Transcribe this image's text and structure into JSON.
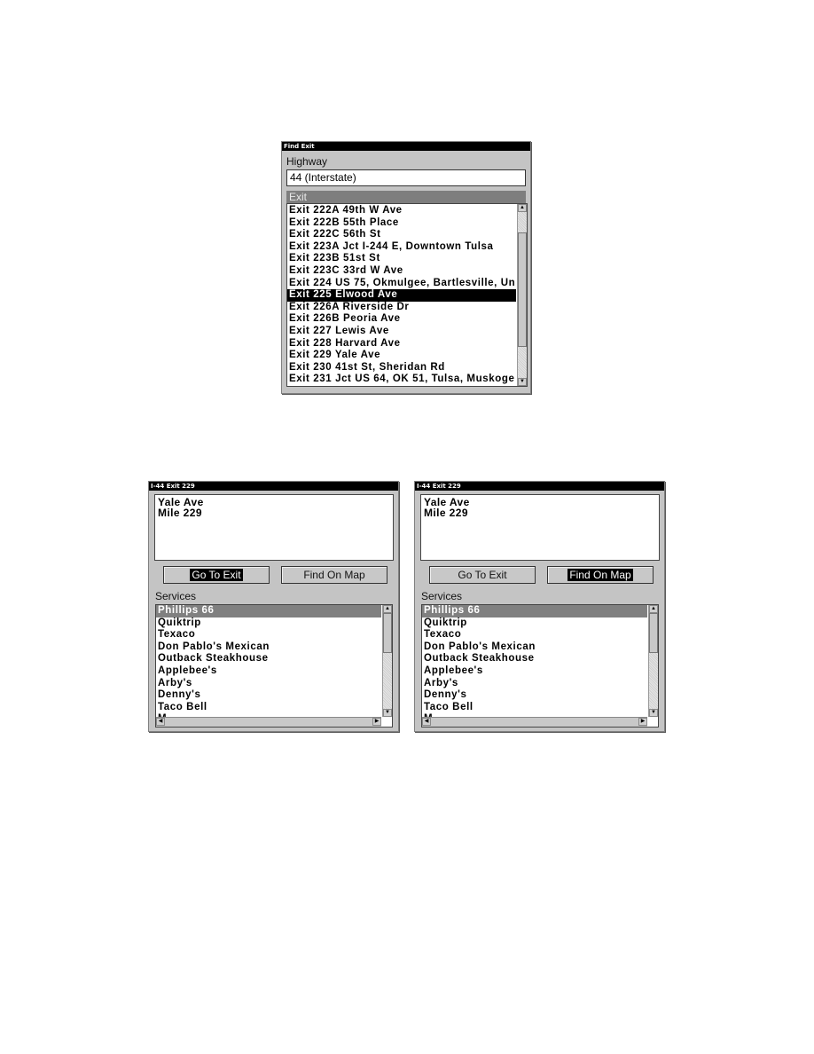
{
  "find_exit_dialog": {
    "title": "Find Exit",
    "highway_label": "Highway",
    "highway_value": "44 (Interstate)",
    "exit_section_label": "Exit",
    "selected_index": 8,
    "exits": [
      "Exit 222A 49th W Ave",
      "Exit 222B 55th Place",
      "Exit 222C 56th St",
      "Exit 223A Jct I-244 E, Downtown Tulsa",
      "Exit 223B 51st St",
      "Exit 223C 33rd W Ave",
      "Exit 224 US 75, Okmulgee, Bartlesville, Un",
      "Exit 225 Elwood Ave",
      "Exit 226A Riverside Dr",
      "Exit 226B Peoria Ave",
      "Exit 227 Lewis Ave",
      "Exit 228 Harvard Ave",
      "Exit 229 Yale Ave",
      "Exit 230 41st St, Sheridan Rd",
      "Exit 231 Jct US 64, OK 51, Tulsa, Muskoge"
    ],
    "scroll_up_icon": "▲",
    "scroll_down_icon": "▼"
  },
  "exit_detail_dialogs": [
    {
      "title": "I-44 Exit 229",
      "info_lines": [
        "Yale Ave",
        "Mile 229"
      ],
      "buttons": {
        "go_to_exit": "Go To Exit",
        "find_on_map": "Find On Map"
      },
      "focused_button": "go_to_exit",
      "services_label": "Services",
      "services": [
        "Phillips 66",
        "Quiktrip",
        "Texaco",
        "Don Pablo's Mexican",
        "Outback Steakhouse",
        "Applebee's",
        "Arby's",
        "Denny's",
        "Taco Bell",
        "M"
      ],
      "selected_service": "Phillips 66"
    },
    {
      "title": "I-44 Exit 229",
      "info_lines": [
        "Yale Ave",
        "Mile 229"
      ],
      "buttons": {
        "go_to_exit": "Go To Exit",
        "find_on_map": "Find On Map"
      },
      "focused_button": "find_on_map",
      "services_label": "Services",
      "services": [
        "Phillips 66",
        "Quiktrip",
        "Texaco",
        "Don Pablo's Mexican",
        "Outback Steakhouse",
        "Applebee's",
        "Arby's",
        "Denny's",
        "Taco Bell",
        "M"
      ],
      "selected_service": "Phillips 66"
    }
  ],
  "icons": {
    "up": "▲",
    "down": "▼",
    "left": "◀",
    "right": "▶"
  }
}
